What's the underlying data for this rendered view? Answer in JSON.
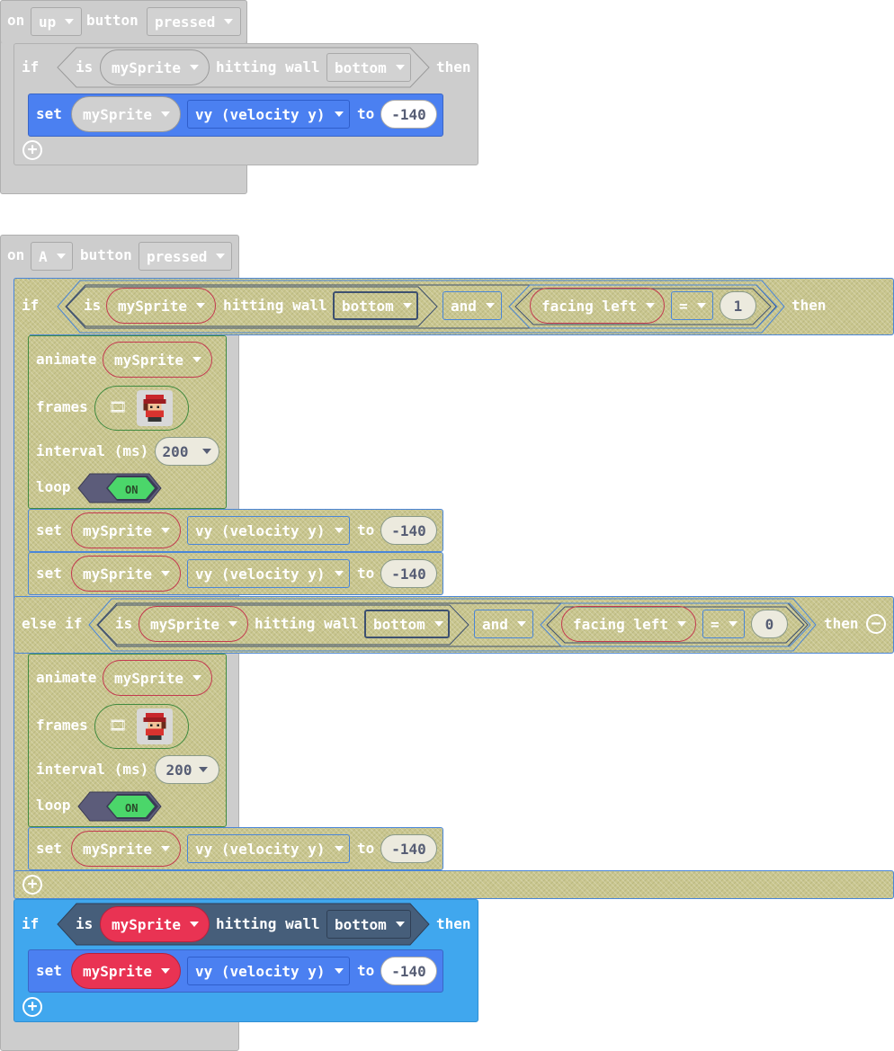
{
  "common": {
    "on": "on",
    "button": "button",
    "if": "if",
    "is": "is",
    "hitting_wall": "hitting wall",
    "then": "then",
    "set": "set",
    "to": "to",
    "and": "and",
    "else_if": "else if",
    "animate": "animate",
    "frames": "frames",
    "interval": "interval (ms)",
    "loop": "loop",
    "sprite": "mySprite",
    "wall": "bottom",
    "property": "vy (velocity y)",
    "pressed": "pressed",
    "facing_left": "facing left",
    "eq": "=",
    "on_toggle": "ON"
  },
  "block1": {
    "key": "up",
    "value": "-140"
  },
  "block2": {
    "key": "A",
    "cond1_value": "1",
    "cond2_value": "0",
    "interval1": "200",
    "interval2": "200",
    "set_values": [
      "-140",
      "-140",
      "-140"
    ],
    "inner_if_value": "-140"
  },
  "colors": {
    "event_gray": "#cdcdcd",
    "set_blue": "#4b80f1",
    "logic_blue": "#40a7ee",
    "sprite_red": "#e93353",
    "disabled_olive": "#c9c68f"
  },
  "icons": [
    "caret-down-icon",
    "add-icon",
    "remove-icon",
    "filmstrip-icon",
    "sprite-thumbnail-icon"
  ]
}
